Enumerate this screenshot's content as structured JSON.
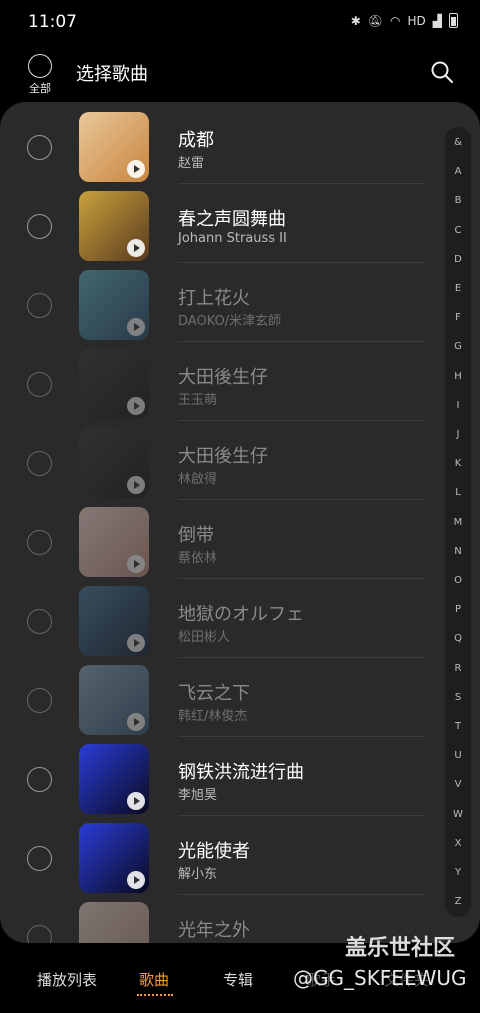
{
  "status_bar": {
    "time": "11:07",
    "icons_text": "HD"
  },
  "header": {
    "select_all_label": "全部",
    "title": "选择歌曲"
  },
  "songs": [
    {
      "title": "成都",
      "artist": "赵雷",
      "dim": false,
      "colors": [
        "#e8c89a",
        "#c9853f"
      ]
    },
    {
      "title": "春之声圆舞曲",
      "artist": "Johann Strauss II",
      "dim": false,
      "colors": [
        "#c9a23c",
        "#5a3a1e"
      ]
    },
    {
      "title": "打上花火",
      "artist": "DAOKO/米津玄師",
      "dim": true,
      "colors": [
        "#5fb3c9",
        "#2a4d6a"
      ]
    },
    {
      "title": "大田後生仔",
      "artist": "王玉萌",
      "dim": true,
      "colors": [
        "#3a3a3a",
        "#1a1a1a"
      ]
    },
    {
      "title": "大田後生仔",
      "artist": "林啟得",
      "dim": true,
      "colors": [
        "#3a3a3a",
        "#1a1a1a"
      ]
    },
    {
      "title": "倒带",
      "artist": "蔡依林",
      "dim": true,
      "colors": [
        "#f3d9d4",
        "#b98a7c"
      ]
    },
    {
      "title": "地獄のオルフェ",
      "artist": "松田彬人",
      "dim": true,
      "colors": [
        "#4a7aa0",
        "#14243a"
      ]
    },
    {
      "title": "飞云之下",
      "artist": "韩红/林俊杰",
      "dim": true,
      "colors": [
        "#8aa8c0",
        "#3a5a78"
      ]
    },
    {
      "title": "钢铁洪流进行曲",
      "artist": "李旭昊",
      "dim": false,
      "colors": [
        "#2a3dd8",
        "#0a0a20"
      ]
    },
    {
      "title": "光能使者",
      "artist": "解小东",
      "dim": false,
      "colors": [
        "#2a3dd8",
        "#0a0a20"
      ]
    },
    {
      "title": "光年之外",
      "artist": "",
      "dim": true,
      "colors": [
        "#e8d0c8",
        "#b09080"
      ]
    }
  ],
  "alpha_index": [
    "&",
    "A",
    "B",
    "C",
    "D",
    "E",
    "F",
    "G",
    "H",
    "I",
    "J",
    "K",
    "L",
    "M",
    "N",
    "O",
    "P",
    "Q",
    "R",
    "S",
    "T",
    "U",
    "V",
    "W",
    "X",
    "Y",
    "Z"
  ],
  "tabs": [
    {
      "label": "播放列表",
      "active": false
    },
    {
      "label": "歌曲",
      "active": true
    },
    {
      "label": "专辑",
      "active": false
    },
    {
      "label": "歌手",
      "active": false
    },
    {
      "label": "文件夹",
      "active": false
    }
  ],
  "watermark": {
    "site": "盖乐世社区",
    "user": "@GG_SKFEEWUG"
  },
  "colors": {
    "accent": "#f29b3a",
    "panel": "#2a2a2a",
    "background": "#000000"
  }
}
